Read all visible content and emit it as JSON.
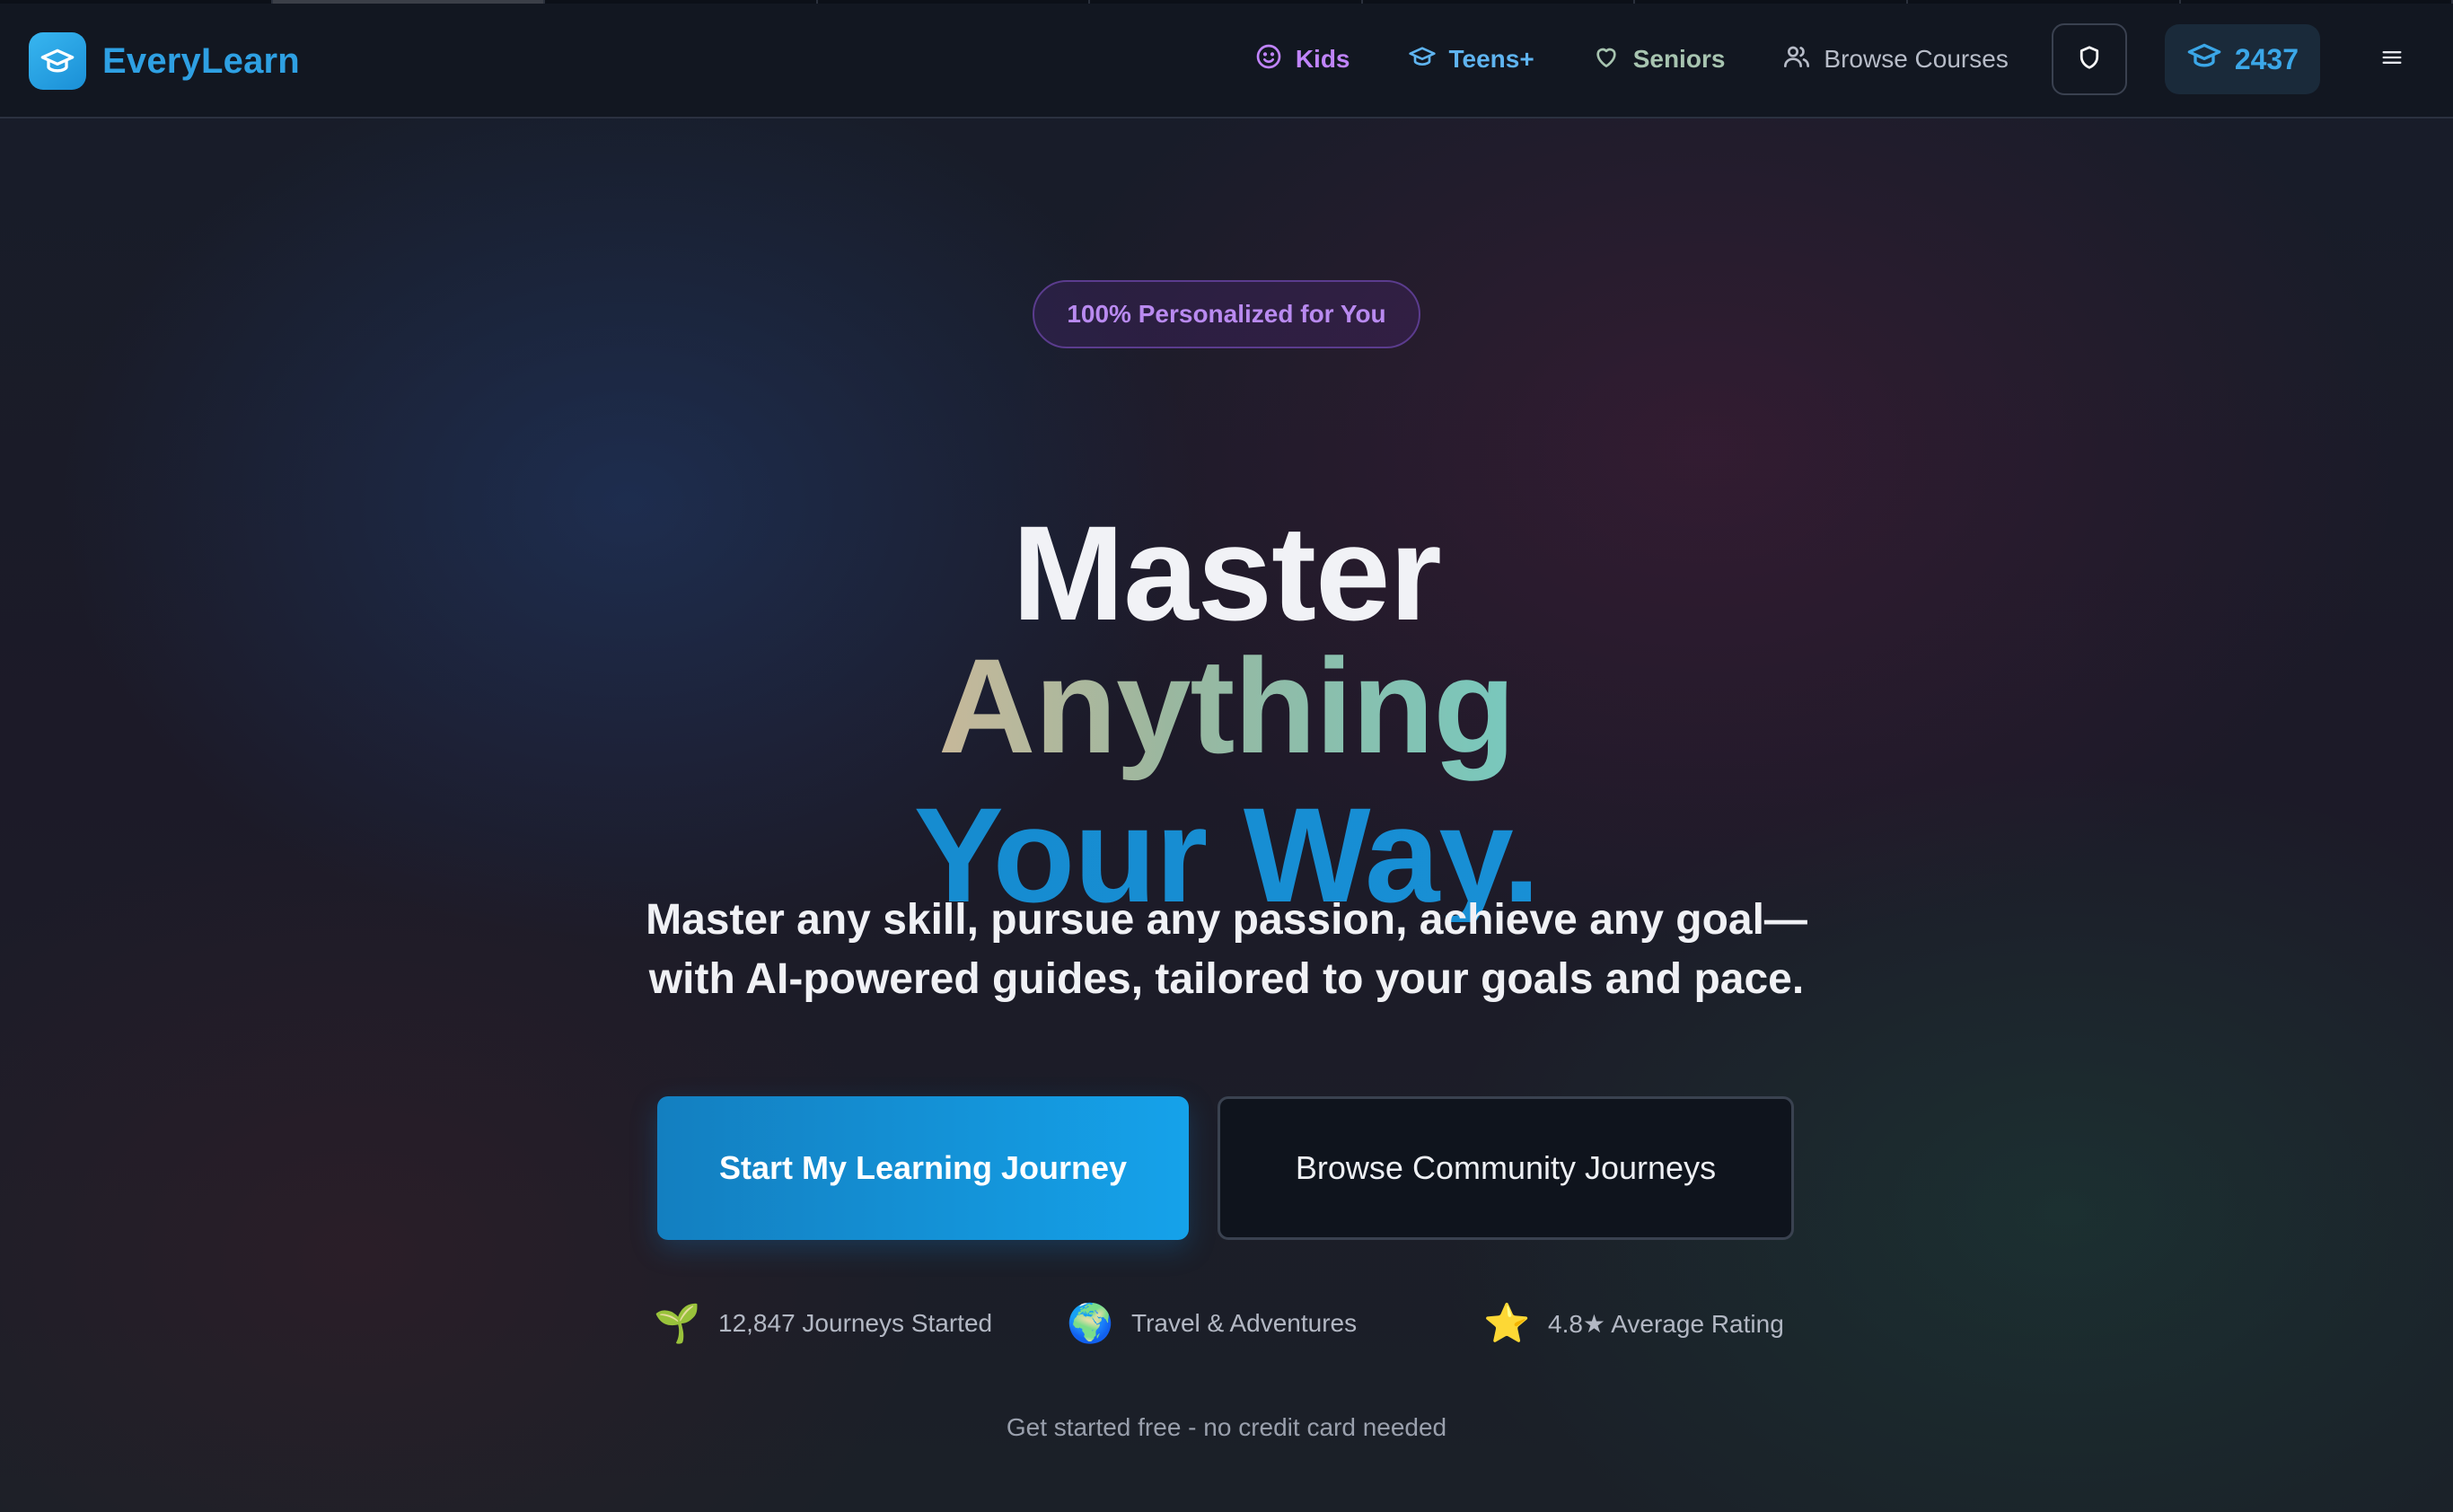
{
  "brand": {
    "name": "EveryLearn"
  },
  "nav": {
    "kids_label": "Kids",
    "teens_label": "Teens+",
    "seniors_label": "Seniors",
    "browse_label": "Browse Courses",
    "points_value": "2437"
  },
  "hero": {
    "badge": "100% Personalized for You",
    "headline_line1": "Master",
    "headline_line2": "Anything",
    "headline_line3": "Your Way.",
    "subtitle_line1": "Master any skill, pursue any passion, achieve any goal—",
    "subtitle_line2": "with AI-powered guides, tailored to your goals and pace.",
    "primary_cta": "Start My Learning Journey",
    "secondary_cta": "Browse Community Journeys",
    "stats": [
      {
        "emoji": "🌱",
        "icon": "seedling-icon",
        "text": "12,847 Journeys Started"
      },
      {
        "emoji": "🌍",
        "icon": "globe-icon",
        "text": "Travel & Adventures"
      },
      {
        "emoji": "⭐",
        "icon": "star-icon",
        "text": "4.8★ Average Rating"
      }
    ],
    "footnote": "Get started free - no credit card needed"
  },
  "colors": {
    "accent": "#2ea0e3",
    "kids": "#c084fc",
    "teens": "#5fb4f0",
    "seniors": "#a7c4b0",
    "background": "#131822"
  }
}
